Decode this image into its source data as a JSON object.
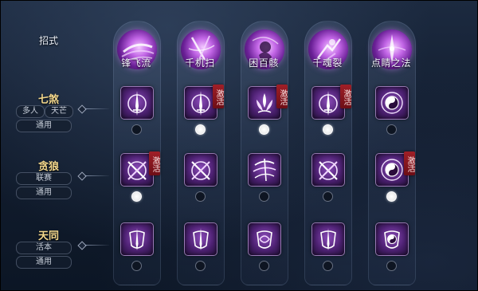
{
  "header": {
    "label": "招式"
  },
  "skills": [
    {
      "name": "锋飞流",
      "icon": "blade-storm-icon"
    },
    {
      "name": "千机扫",
      "icon": "thousand-sweep-icon"
    },
    {
      "name": "困百骸",
      "icon": "bone-bind-icon"
    },
    {
      "name": "千魂裂",
      "icon": "soul-rend-icon"
    },
    {
      "name": "点睛之法",
      "icon": "dot-eye-icon"
    }
  ],
  "rows": [
    {
      "title": "七煞",
      "tags": [
        "多人",
        "天芒",
        "通用"
      ],
      "slots": [
        {
          "icon": "sword-ring-icon",
          "active": false,
          "selected": false
        },
        {
          "icon": "sword-ring-icon",
          "active": true,
          "selected": true
        },
        {
          "icon": "lotus-flame-icon",
          "active": true,
          "selected": true
        },
        {
          "icon": "sword-ring-icon",
          "active": true,
          "selected": true
        },
        {
          "icon": "taiji-ring-icon",
          "active": false,
          "selected": false
        }
      ]
    },
    {
      "title": "贪狼",
      "tags": [
        "联赛",
        "通用"
      ],
      "slots": [
        {
          "icon": "crossed-blades-icon",
          "active": true,
          "selected": true
        },
        {
          "icon": "crossed-blades-icon",
          "active": false,
          "selected": false
        },
        {
          "icon": "wind-slash-icon",
          "active": false,
          "selected": false
        },
        {
          "icon": "crossed-blades-icon",
          "active": false,
          "selected": false
        },
        {
          "icon": "taiji-ring-icon",
          "active": true,
          "selected": true
        }
      ]
    },
    {
      "title": "天同",
      "tags": [
        "活本",
        "通用"
      ],
      "slots": [
        {
          "icon": "shield-sword-icon",
          "active": false,
          "selected": false
        },
        {
          "icon": "shield-sword-icon",
          "active": false,
          "selected": false
        },
        {
          "icon": "swirl-shield-icon",
          "active": false,
          "selected": false
        },
        {
          "icon": "shield-sword-icon",
          "active": false,
          "selected": false
        },
        {
          "icon": "taiji-shield-icon",
          "active": false,
          "selected": false
        }
      ]
    }
  ],
  "badge_text": "激活",
  "colors": {
    "title_gold": "#f4d88c",
    "badge_red": "#a01f27",
    "purple_glow": "#c266e6"
  }
}
